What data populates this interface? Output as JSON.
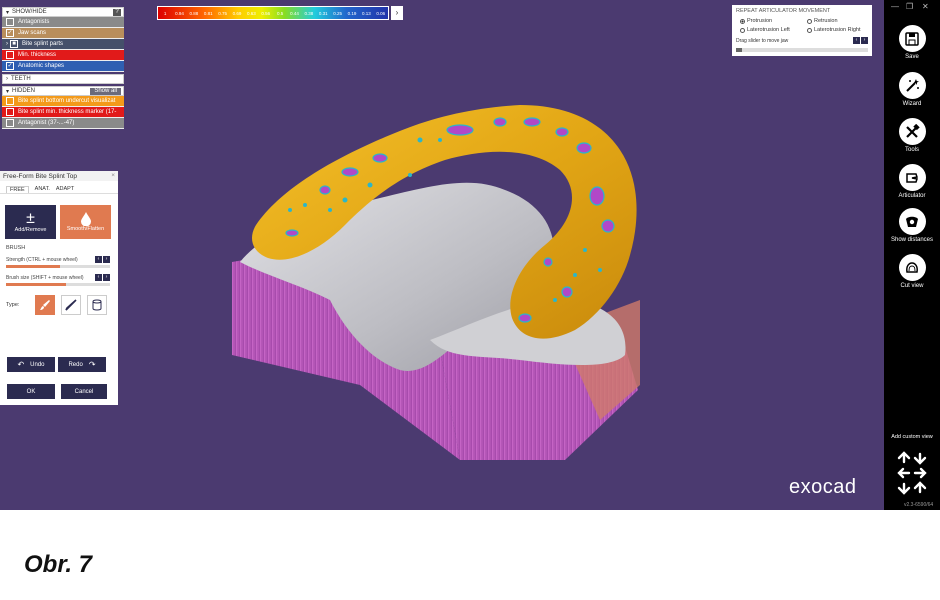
{
  "panels": {
    "showhide": {
      "title": "SHOW/HIDE",
      "help": "?",
      "items": [
        {
          "label": "Antagonists",
          "checked": false,
          "color": "#8a8a8a"
        },
        {
          "label": "Jaw scans",
          "checked": true,
          "color": "#b98e5c"
        },
        {
          "label": "Bite splint parts",
          "checked": true,
          "color": "#45506a"
        },
        {
          "label": "Min. thickness",
          "checked": false,
          "color": "#e11a1a"
        },
        {
          "label": "Anatomic shapes",
          "checked": true,
          "color": "#2f5fb2"
        }
      ]
    },
    "teeth": {
      "title": "TEETH"
    },
    "hidden": {
      "title": "HIDDEN",
      "show_all": "Show all",
      "items": [
        {
          "label": "Bite splint bottom undercut visualizat",
          "checked": false,
          "color": "#f39a1a"
        },
        {
          "label": "Bite splint min. thickness marker (17-",
          "checked": false,
          "color": "#e11a1a"
        },
        {
          "label": "Antagonist (37-...-47)",
          "checked": false,
          "color": "#8a8a8a"
        }
      ]
    }
  },
  "tool_panel": {
    "title": "Free-Form Bite Splint Top",
    "tabs": [
      "FREE",
      "ANAT.",
      "ADAPT"
    ],
    "add_remove": "Add/Remove",
    "smooth_flatten": "Smooth/Flatten",
    "brush_section": "BRUSH",
    "strength_label": "Strength (CTRL + mouse wheel)",
    "strength_value": 0.52,
    "size_label": "Brush size (SHIFT + mouse wheel)",
    "size_value": 0.58,
    "type_label": "Type:",
    "undo": "Undo",
    "redo": "Redo",
    "ok": "OK",
    "cancel": "Cancel"
  },
  "color_scale": {
    "labels": [
      "1",
      "0.94",
      "0.88",
      "0.81",
      "0.75",
      "0.69",
      "0.63",
      "0.56",
      "0.5",
      "0.44",
      "0.38",
      "0.31",
      "0.25",
      "0.19",
      "0.13",
      "0.06"
    ]
  },
  "articulator": {
    "title": "REPEAT ARTICULATOR MOVEMENT",
    "options": [
      "Protrusion",
      "Retrusion",
      "Laterotrusion Left",
      "Laterotrusion Right"
    ],
    "selected": "Protrusion",
    "slider_label": "Drag slider to move jaw"
  },
  "toolbar": {
    "tools": [
      {
        "label": "Save",
        "icon": "save-icon"
      },
      {
        "label": "Wizard",
        "icon": "wizard-icon"
      },
      {
        "label": "Tools",
        "icon": "tools-icon"
      },
      {
        "label": "Articulator",
        "icon": "articulator-icon"
      },
      {
        "label": "Show distances",
        "icon": "show-distances-icon"
      },
      {
        "label": "Cut view",
        "icon": "cut-view-icon"
      }
    ],
    "add_custom_view": "Add custom view",
    "version": "v2.3-6590/64"
  },
  "logo": "exocad",
  "caption": "Obr. 7",
  "colors": {
    "viewport": "#4b3a70",
    "splint": "#e8a917",
    "jaw_gray": "#c9c9cd",
    "base_magenta": "#b94bb4",
    "panel_dark": "#2b2b50",
    "accent_orange": "#e07a50"
  }
}
